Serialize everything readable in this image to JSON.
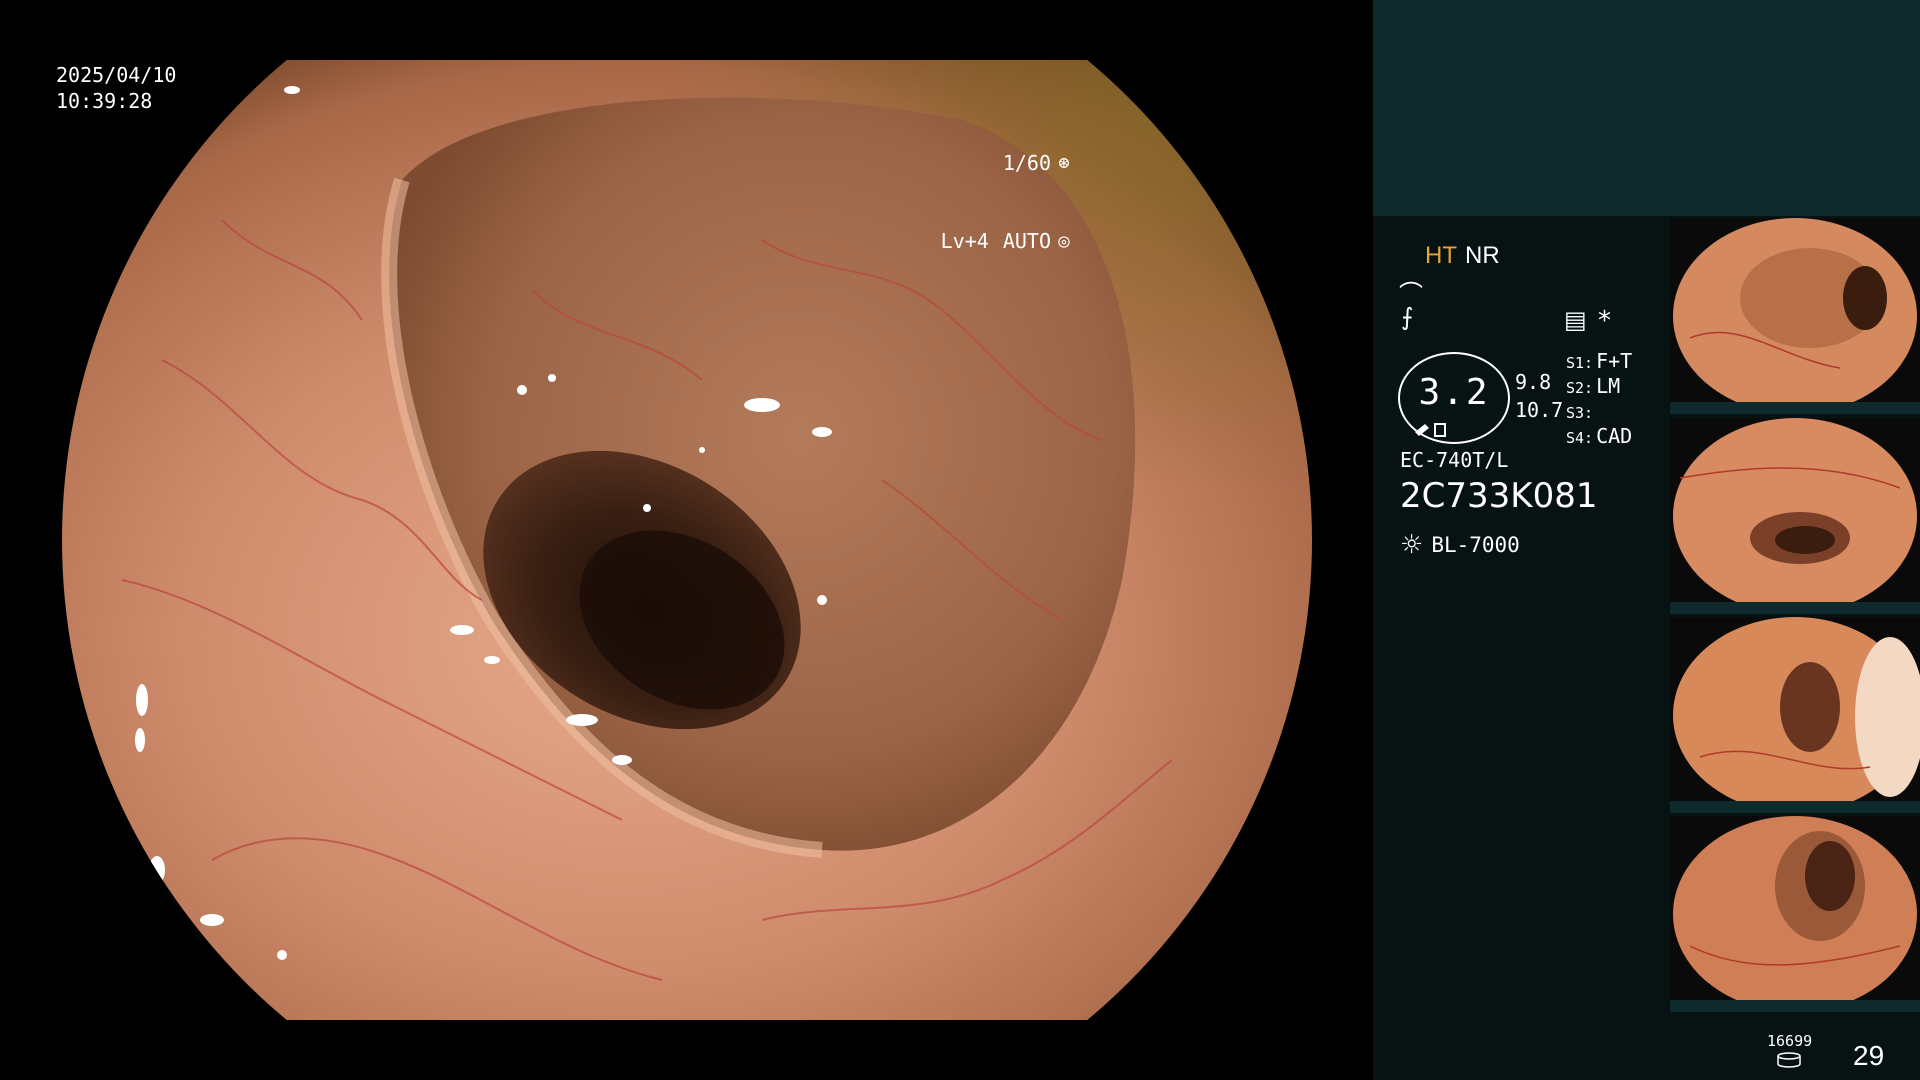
{
  "osd": {
    "date": "2025/04/10",
    "time": "10:39:28",
    "shutter": "1/60",
    "level": "Lv+4",
    "iris": "AUTO"
  },
  "panel": {
    "ht": "HT",
    "nr": "NR",
    "zoom": "3.2",
    "focus_a": "9.8",
    "focus_b": "10.7",
    "switches": [
      {
        "key": "S1:",
        "value": "F+T"
      },
      {
        "key": "S2:",
        "value": "LM"
      },
      {
        "key": "S3:",
        "value": ""
      },
      {
        "key": "S4:",
        "value": "CAD"
      }
    ],
    "scope_model": "EC-740T/L",
    "scope_serial": "2C733K081",
    "light_source": "BL-7000",
    "disk_remaining": "16699",
    "frame_count": "29"
  },
  "icons": {
    "shutter": "aperture-icon",
    "iris": "iris-icon",
    "enhance": "enhancement-icon",
    "structure": "structure-icon",
    "preset": "preset-icon",
    "star": "asterisk-icon",
    "light": "sun-icon",
    "disk": "disk-icon"
  },
  "colors": {
    "ht": "#e8a23a",
    "top_panel": "#0e2a2c",
    "info_panel": "#071213"
  }
}
